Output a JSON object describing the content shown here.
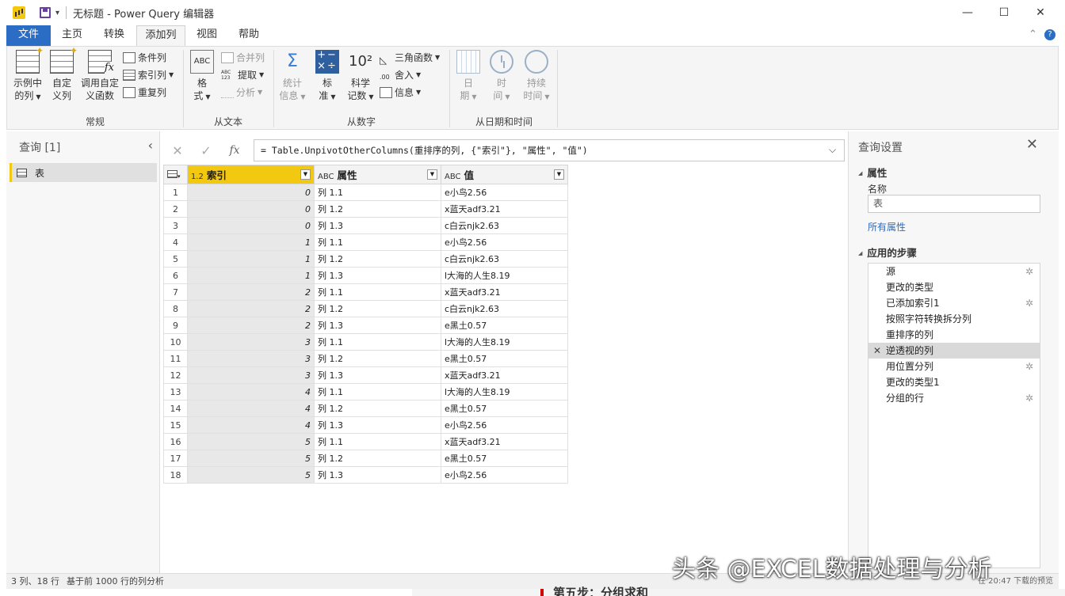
{
  "window": {
    "title": "无标题 - Power Query 编辑器",
    "minimize": "—",
    "maximize": "☐",
    "close": "✕"
  },
  "tabs": [
    "文件",
    "主页",
    "转换",
    "添加列",
    "视图",
    "帮助"
  ],
  "active_tab": "添加列",
  "ribbon": {
    "groups": {
      "general": "常规",
      "from_text": "从文本",
      "from_number": "从数字",
      "from_datetime": "从日期和时间"
    },
    "general": {
      "example_col_1": "示例中",
      "example_col_2": "的列",
      "custom_col_1": "自定",
      "custom_col_2": "义列",
      "invoke_fn_1": "调用自定",
      "invoke_fn_2": "义函数",
      "conditional": "条件列",
      "index": "索引列",
      "duplicate": "重复列"
    },
    "text": {
      "format_1": "格",
      "format_2": "式",
      "merge": "合并列",
      "extract": "提取",
      "extract_icon": "ABC 123",
      "parse": "分析",
      "abc_icon": "ABC"
    },
    "number": {
      "stats_1": "统计",
      "stats_2": "信息",
      "std_1": "标",
      "std_2": "准",
      "sci_1": "科学",
      "sci_2": "记数",
      "sci_icon": "10²",
      "trig": "三角函数",
      "round": "舍入",
      "info": "信息"
    },
    "datetime": {
      "date_1": "日",
      "date_2": "期",
      "time_1": "时",
      "time_2": "间",
      "duration_1": "持续",
      "duration_2": "时间"
    }
  },
  "queries_pane": {
    "title": "查询 [1]",
    "items": [
      {
        "label": "表"
      }
    ]
  },
  "formula": "= Table.UnpivotOtherColumns(重排序的列, {\"索引\"}, \"属性\", \"值\")",
  "table": {
    "columns": [
      {
        "type": "1.2",
        "name": "索引"
      },
      {
        "type": "ABC",
        "name": "属性"
      },
      {
        "type": "ABC",
        "name": "值"
      }
    ],
    "rows": [
      [
        "1",
        "0",
        "列 1.1",
        "e小鸟2.56"
      ],
      [
        "2",
        "0",
        "列 1.2",
        "x蓝天adf3.21"
      ],
      [
        "3",
        "0",
        "列 1.3",
        "c白云njk2.63"
      ],
      [
        "4",
        "1",
        "列 1.1",
        "e小鸟2.56"
      ],
      [
        "5",
        "1",
        "列 1.2",
        "c白云njk2.63"
      ],
      [
        "6",
        "1",
        "列 1.3",
        "l大海的人生8.19"
      ],
      [
        "7",
        "2",
        "列 1.1",
        "x蓝天adf3.21"
      ],
      [
        "8",
        "2",
        "列 1.2",
        "c白云njk2.63"
      ],
      [
        "9",
        "2",
        "列 1.3",
        "e黑土0.57"
      ],
      [
        "10",
        "3",
        "列 1.1",
        "l大海的人生8.19"
      ],
      [
        "11",
        "3",
        "列 1.2",
        "e黑土0.57"
      ],
      [
        "12",
        "3",
        "列 1.3",
        "x蓝天adf3.21"
      ],
      [
        "13",
        "4",
        "列 1.1",
        "l大海的人生8.19"
      ],
      [
        "14",
        "4",
        "列 1.2",
        "e黑土0.57"
      ],
      [
        "15",
        "4",
        "列 1.3",
        "e小鸟2.56"
      ],
      [
        "16",
        "5",
        "列 1.1",
        "x蓝天adf3.21"
      ],
      [
        "17",
        "5",
        "列 1.2",
        "e黑土0.57"
      ],
      [
        "18",
        "5",
        "列 1.3",
        "e小鸟2.56"
      ]
    ]
  },
  "settings": {
    "title": "查询设置",
    "properties_label": "属性",
    "name_label": "名称",
    "name_value": "表",
    "all_properties": "所有属性",
    "steps_label": "应用的步骤",
    "steps": [
      {
        "label": "源",
        "gear": true,
        "active": false
      },
      {
        "label": "更改的类型",
        "gear": false,
        "active": false
      },
      {
        "label": "已添加索引1",
        "gear": true,
        "active": false
      },
      {
        "label": "按照字符转换拆分列",
        "gear": false,
        "active": false
      },
      {
        "label": "重排序的列",
        "gear": false,
        "active": false
      },
      {
        "label": "逆透视的列",
        "gear": false,
        "active": true
      },
      {
        "label": "用位置分列",
        "gear": true,
        "active": false
      },
      {
        "label": "更改的类型1",
        "gear": false,
        "active": false
      },
      {
        "label": "分组的行",
        "gear": true,
        "active": false
      }
    ]
  },
  "status": {
    "counts": "3 列、18 行",
    "profile": "基于前 1000 行的列分析",
    "preview": "在 20:47 下载的预览"
  },
  "watermark": "头条 @EXCEL数据处理与分析",
  "underlay_text": "第五步：分组求和",
  "colors": {
    "accent": "#2b6cc4",
    "selected_column": "#f2c811",
    "quality_bar": "#1fb5a8"
  }
}
